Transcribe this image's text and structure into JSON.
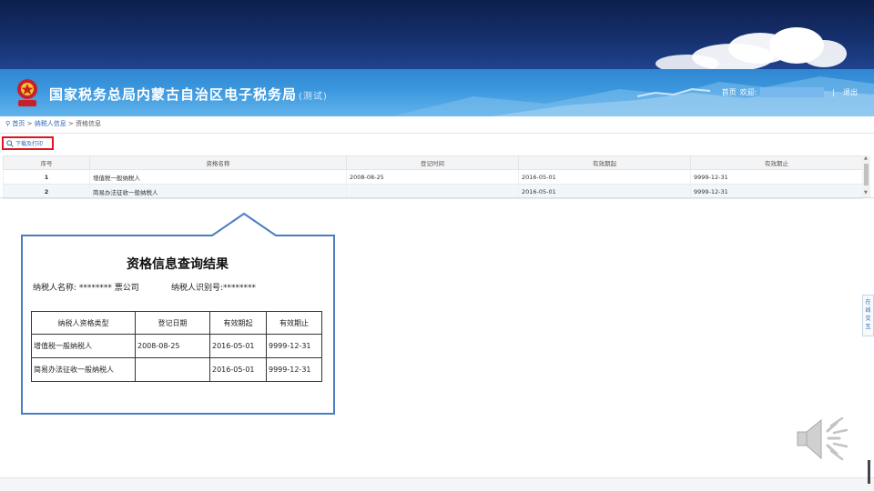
{
  "header": {
    "site_title": "国家税务总局内蒙古自治区电子税务局",
    "test_tag": "(测试)",
    "home_link": "首页",
    "welcome": "欢迎:",
    "logout": "退出"
  },
  "breadcrumb": {
    "home": "首页",
    "section": "纳税人信息",
    "current": "资格信息",
    "separator": ">"
  },
  "toolbar": {
    "download_label": "下载及打印"
  },
  "grid": {
    "columns": [
      "序号",
      "资格名称",
      "登记时间",
      "有效期起",
      "有效期止"
    ],
    "rows": [
      [
        "1",
        "增值税一般纳税人",
        "2008-08-25",
        "2016-05-01",
        "9999-12-31"
      ],
      [
        "2",
        "简易办法征收一般纳税人",
        "",
        "2016-05-01",
        "9999-12-31"
      ]
    ]
  },
  "result": {
    "title": "资格信息查询结果",
    "taxpayer_name_label": "纳税人名称:",
    "taxpayer_name_value": "******** 票公司",
    "taxpayer_id_label": "纳税人识别号:",
    "taxpayer_id_value": "********",
    "columns": [
      "纳税人资格类型",
      "登记日期",
      "有效期起",
      "有效期止"
    ],
    "rows": [
      [
        "增值税一般纳税人",
        "2008-08-25",
        "2016-05-01",
        "9999-12-31"
      ],
      [
        "简易办法征收一般纳税人",
        "",
        "2016-05-01",
        "9999-12-31"
      ]
    ]
  },
  "side_tab": {
    "label_1": "在",
    "label_2": "线",
    "label_3": "交",
    "label_4": "互"
  },
  "icons": {
    "location": "map-pin-icon",
    "search": "search-icon",
    "emblem": "tax-emblem-icon",
    "speaker": "speaker-icon"
  },
  "colors": {
    "header_blue": "#3c98de",
    "banner_dark": "#0e1f4e",
    "highlight_red": "#e0141d",
    "link_blue": "#2c67b5",
    "callout_border": "#4a7cc2"
  }
}
